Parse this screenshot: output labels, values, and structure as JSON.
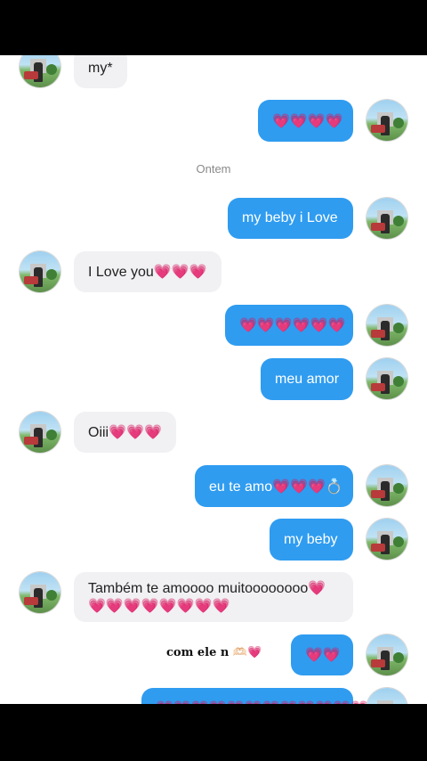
{
  "date_separator": "Ontem",
  "messages": [
    {
      "text": "my*"
    },
    {
      "text": "💗💗💗💗"
    },
    {
      "text": "my beby i Love"
    },
    {
      "text": "I Love you💗💗💗"
    },
    {
      "text": "💗💗💗💗💗💗"
    },
    {
      "text": "meu amor"
    },
    {
      "text": "Oiii💗💗💗"
    },
    {
      "text": "eu te amo💗💗💗💍"
    },
    {
      "text": "my beby"
    },
    {
      "text": "Também te amoooo muitoooooooo💗 💗💗💗💗💗💗💗💗"
    },
    {
      "text": "💗💗"
    },
    {
      "text": "💗💗💗💗💗💗💗💗💗💗💗💗"
    }
  ],
  "caption": "com ele n 🫶🏻💗",
  "colors": {
    "outgoing": "#2f9cf0",
    "incoming": "#f1f0f3"
  }
}
